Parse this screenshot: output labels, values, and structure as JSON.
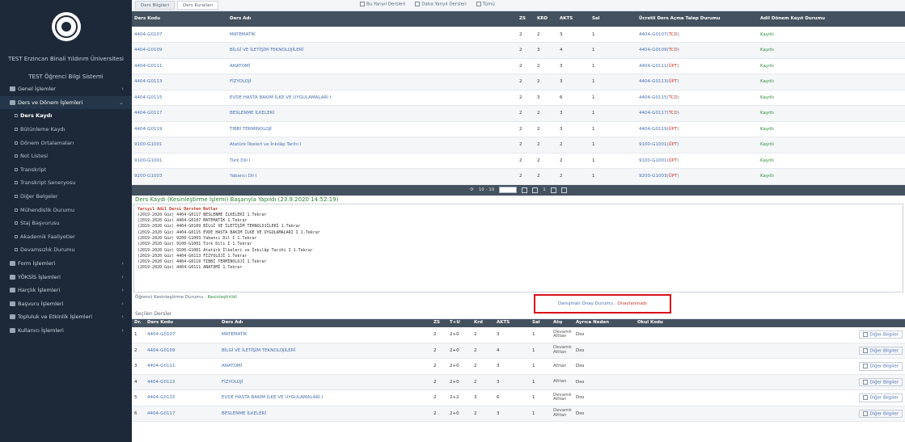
{
  "sidebar": {
    "university": "TEST Erzincan Binali Yıldırım Üniversitesi",
    "system": "TEST Öğrenci Bilgi Sistemi",
    "items": [
      {
        "label": "Genel İşlemler",
        "icon": "grid-icon"
      },
      {
        "label": "Ders ve Dönem İşlemleri",
        "icon": "book-icon"
      },
      {
        "label": "Form İşlemleri",
        "icon": "form-icon"
      },
      {
        "label": "YÖKSİS İşlemleri",
        "icon": "link-icon"
      },
      {
        "label": "Harçlık İşlemleri",
        "icon": "money-icon"
      },
      {
        "label": "Başvuru İşlemleri",
        "icon": "folder-icon"
      },
      {
        "label": "Topluluk ve Etkinlik İşlemleri",
        "icon": "users-icon"
      },
      {
        "label": "Kullanıcı İşlemleri",
        "icon": "user-icon"
      }
    ],
    "subitems": [
      "Ders Kaydı",
      "Bütünleme Kaydı",
      "Dönem Ortalamaları",
      "Not Listesi",
      "Transkript",
      "Transkript Seneryosu",
      "Diğer Belgeler",
      "Mühendislik Durumu",
      "Staj Başvurusu",
      "Akademik Faaliyetler",
      "Devamsızlık Durumu"
    ]
  },
  "top": {
    "tabs": [
      "Ders Bilgileri",
      "Ders Kuralları"
    ],
    "filters": [
      "Bu Yarıyıl Dersleri",
      "Daha Yarıyıl Dersleri",
      "Tümü"
    ]
  },
  "table1": {
    "headers": [
      "Ders Kodu",
      "Ders Adı",
      "ZS",
      "KRD",
      "AKTS",
      "Sal",
      "Ücretli Ders Açma Talep Durumu",
      "Adil Dönem Kayıt Durumu"
    ],
    "rows": [
      {
        "code": "4404-G0107",
        "name": "MATEMATİK",
        "zs": "2",
        "krd": "2",
        "akts": "3",
        "sal": "1",
        "closed_code": "4404-G0107",
        "closed_tag": "TCD",
        "status": "Kayıtlı"
      },
      {
        "code": "4404-G0109",
        "name": "BİLGİ VE İLETİŞİM TEKNOLOJİLERİ",
        "zs": "2",
        "krd": "3",
        "akts": "4",
        "sal": "1",
        "closed_code": "4404-G0109",
        "closed_tag": "TCD",
        "status": "Kayıtlı"
      },
      {
        "code": "4404-G0111",
        "name": "ANATOMİ",
        "zs": "2",
        "krd": "2",
        "akts": "3",
        "sal": "1",
        "closed_code": "4404-G0111",
        "closed_tag": "ÜPT",
        "status": "Kayıtlı"
      },
      {
        "code": "4404-G0113",
        "name": "FİZYOLOJİ",
        "zs": "2",
        "krd": "2",
        "akts": "3",
        "sal": "1",
        "closed_code": "4404-G0113",
        "closed_tag": "ÜPT",
        "status": "Kayıtlı"
      },
      {
        "code": "4404-G0115",
        "name": "EVDE HASTA BAKIM İLKE VE UYGULAMALARI I",
        "zs": "2",
        "krd": "3",
        "akts": "6",
        "sal": "1",
        "closed_code": "4404-G0115",
        "closed_tag": "TCD",
        "status": "Kayıtlı"
      },
      {
        "code": "4404-G0117",
        "name": "BESLENME İLKELERİ",
        "zs": "2",
        "krd": "2",
        "akts": "3",
        "sal": "1",
        "closed_code": "4404-G0117",
        "closed_tag": "TCD",
        "status": "Kayıtlı"
      },
      {
        "code": "4404-G0119",
        "name": "TIBBİ TERMİNOLOJİ",
        "zs": "2",
        "krd": "2",
        "akts": "3",
        "sal": "1",
        "closed_code": "4404-G0119",
        "closed_tag": "ÜPT",
        "status": "Kayıtlı"
      },
      {
        "code": "9100-G1001",
        "name": "Atatürk İlkeleri ve İnkılâp Tarihi I",
        "zs": "2",
        "krd": "2",
        "akts": "2",
        "sal": "1",
        "closed_code": "9100-G1001",
        "closed_tag": "ÜPT",
        "status": "Kayıtlı"
      },
      {
        "code": "9100-G1001",
        "name": "Türk Dili I",
        "zs": "2",
        "krd": "2",
        "akts": "2",
        "sal": "1",
        "closed_code": "9100-G1001",
        "closed_tag": "ÜPT",
        "status": "Kayıtlı"
      },
      {
        "code": "9200-G1003",
        "name": "Yabancı Dil I",
        "zs": "2",
        "krd": "2",
        "akts": "2",
        "sal": "1",
        "closed_code": "9200-G1003",
        "closed_tag": "ÜPT",
        "status": "Kayıtlı"
      }
    ]
  },
  "pager": {
    "info": "10 - 10",
    "page": "1"
  },
  "registration": {
    "title": "Ders Kaydı (Kesinleştirme İşlemi) Başarıyla Yapıldı (23.9.2020 14:52:19)",
    "log_header": "Yarıyıl  Adil Dersi  Dersten Notlar",
    "log_lines": [
      "(2019-2020 Güz) 4404-G0117 BESLENME İLKELERİ 1.Tekrar",
      "(2019-2020 Güz) 4404-G0107 MATEMATİK 1.Tekrar",
      "(2019-2020 Güz) 4404-G0109 BİLGİ VE İLETİŞİM TEKNOLOJİLERİ 1.Tekrar",
      "(2019-2020 Güz) 4404-G0115 EVDE HASTA BAKIM İLKE VE UYGULAMALARI I 1.Tekrar",
      "(2019-2020 Güz) 9200-G1003 Yabancı Dil I 1.Tekrar",
      "(2019-2020 Güz) 9100-G1001 Türk Dili I 1.Tekrar",
      "(2019-2020 Güz) 9100-G1001 Atatürk İlkeleri ve İnkılâp Tarihi I 1.Tekrar",
      "(2019-2020 Güz) 4404-G0113 FİZYOLOJİ 1.Tekrar",
      "(2019-2020 Güz) 4404-G0119 TIBBİ TERMİNOLOJİ 1.Tekrar",
      "(2019-2020 Güz) 4404-G0111 ANATOMİ 1.Tekrar"
    ]
  },
  "status": {
    "left_label": "Öğrenci Kesinleştirme Durumu :",
    "left_value": "Kesinleştirildi",
    "right_label": "Danışman Onay Durumu :",
    "right_value": "Onaylanmadı"
  },
  "table2": {
    "title": "Seçilen Dersler",
    "headers": [
      "Dr.",
      "Ders Kodu",
      "Ders Adı",
      "ZS",
      "T+U",
      "Krd",
      "AKTS",
      "Sal",
      "Alış",
      "Ayrıca Neden",
      "Okul Kodu"
    ],
    "rows": [
      {
        "no": "1",
        "code": "4404-G0107",
        "name": "MATEMATİK",
        "zs": "2",
        "tu": "2+0",
        "krd": "2",
        "akts": "3",
        "sal": "1",
        "alis": "Devamlı Alttan",
        "neden": "Dıııı",
        "btn": "Diğer Bilgiler"
      },
      {
        "no": "2",
        "code": "4404-G0109",
        "name": "BİLGİ VE İLETİŞİM TEKNOLOJİLERİ",
        "zs": "2",
        "tu": "2+0",
        "krd": "2",
        "akts": "4",
        "sal": "1",
        "alis": "Devamlı Alttan",
        "neden": "Dıııı",
        "btn": "Diğer Bilgiler"
      },
      {
        "no": "3",
        "code": "4404-G0111",
        "name": "ANATOMİ",
        "zs": "2",
        "tu": "2+0",
        "krd": "2",
        "akts": "3",
        "sal": "1",
        "alis": "Alttan",
        "neden": "Dıııı",
        "btn": "Diğer Bilgiler"
      },
      {
        "no": "4",
        "code": "4404-G0113",
        "name": "FİZYOLOJİ",
        "zs": "2",
        "tu": "2+0",
        "krd": "2",
        "akts": "3",
        "sal": "1",
        "alis": "Alttan",
        "neden": "Dıııı",
        "btn": "Diğer Bilgiler"
      },
      {
        "no": "5",
        "code": "4404-G0115",
        "name": "EVDE HASTA BAKIM İLKE VE UYGULAMALARI I",
        "zs": "2",
        "tu": "2+2",
        "krd": "3",
        "akts": "6",
        "sal": "1",
        "alis": "Devamlı Alttan",
        "neden": "Dıııı",
        "btn": "Diğer Bilgiler"
      },
      {
        "no": "6",
        "code": "4404-G0117",
        "name": "BESLENME İLKELERİ",
        "zs": "2",
        "tu": "2+0",
        "krd": "2",
        "akts": "3",
        "sal": "1",
        "alis": "Devamlı Alttan",
        "neden": "Dıııı",
        "btn": "Diğer Bilgiler"
      }
    ]
  },
  "colors": {
    "sidebar": "#1d2939",
    "header": "#44515f",
    "highlight": "#d9111b",
    "success": "#2e7d32"
  }
}
